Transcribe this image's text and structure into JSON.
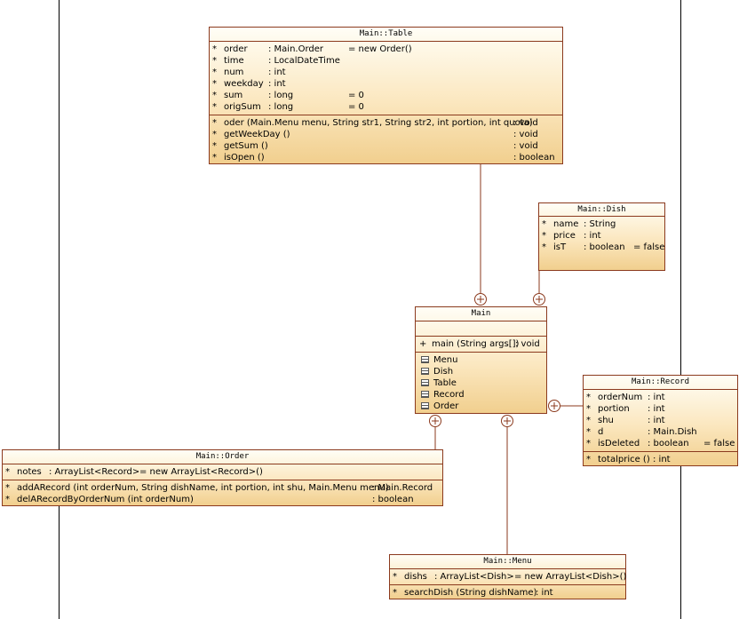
{
  "classes": {
    "table": {
      "title": "Main::Table",
      "attributes": [
        {
          "vis": "*",
          "name": "order",
          "type": ": Main.Order",
          "init": "= new Order()"
        },
        {
          "vis": "*",
          "name": "time",
          "type": ": LocalDateTime",
          "init": ""
        },
        {
          "vis": "*",
          "name": "num",
          "type": ": int",
          "init": ""
        },
        {
          "vis": "*",
          "name": "weekday",
          "type": ": int",
          "init": ""
        },
        {
          "vis": "*",
          "name": "sum",
          "type": ": long",
          "init": "= 0"
        },
        {
          "vis": "*",
          "name": "origSum",
          "type": ": long",
          "init": "= 0"
        }
      ],
      "operations": [
        {
          "vis": "*",
          "sig": "oder (Main.Menu menu, String str1, String str2, int portion, int quota)",
          "ret": ": void"
        },
        {
          "vis": "*",
          "sig": "getWeekDay ()",
          "ret": ": void"
        },
        {
          "vis": "*",
          "sig": "getSum ()",
          "ret": ": void"
        },
        {
          "vis": "*",
          "sig": "isOpen ()",
          "ret": ": boolean"
        }
      ]
    },
    "dish": {
      "title": "Main::Dish",
      "attributes": [
        {
          "vis": "*",
          "name": "name",
          "type": ": String",
          "init": ""
        },
        {
          "vis": "*",
          "name": "price",
          "type": ": int",
          "init": ""
        },
        {
          "vis": "*",
          "name": "isT",
          "type": ": boolean",
          "init": "= false"
        }
      ]
    },
    "main": {
      "title": "Main",
      "operations": [
        {
          "vis": "+",
          "sig": "main (String args[])",
          "ret": ": void"
        }
      ],
      "nested": [
        "Menu",
        "Dish",
        "Table",
        "Record",
        "Order"
      ]
    },
    "record": {
      "title": "Main::Record",
      "attributes": [
        {
          "vis": "*",
          "name": "orderNum",
          "type": ": int",
          "init": ""
        },
        {
          "vis": "*",
          "name": "portion",
          "type": ": int",
          "init": ""
        },
        {
          "vis": "*",
          "name": "shu",
          "type": ": int",
          "init": ""
        },
        {
          "vis": "*",
          "name": "d",
          "type": ": Main.Dish",
          "init": ""
        },
        {
          "vis": "*",
          "name": "isDeleted",
          "type": ": boolean",
          "init": "= false"
        }
      ],
      "operations": [
        {
          "vis": "*",
          "sig": "totalprice ()",
          "ret": ": int"
        }
      ]
    },
    "order": {
      "title": "Main::Order",
      "attributes": [
        {
          "vis": "*",
          "name": "notes",
          "type": ": ArrayList<Record>",
          "init": "= new ArrayList<Record>()"
        }
      ],
      "operations": [
        {
          "vis": "*",
          "sig": "addARecord (int orderNum, String dishName, int portion, int shu, Main.Menu menu)",
          "ret": ": Main.Record"
        },
        {
          "vis": "*",
          "sig": "delARecordByOrderNum (int orderNum)",
          "ret": ": boolean"
        }
      ]
    },
    "menu": {
      "title": "Main::Menu",
      "attributes": [
        {
          "vis": "*",
          "name": "dishs",
          "type": ": ArrayList<Dish>",
          "init": "= new ArrayList<Dish>()"
        }
      ],
      "operations": [
        {
          "vis": "*",
          "sig": "searchDish (String dishName)",
          "ret": ": int"
        }
      ]
    }
  }
}
